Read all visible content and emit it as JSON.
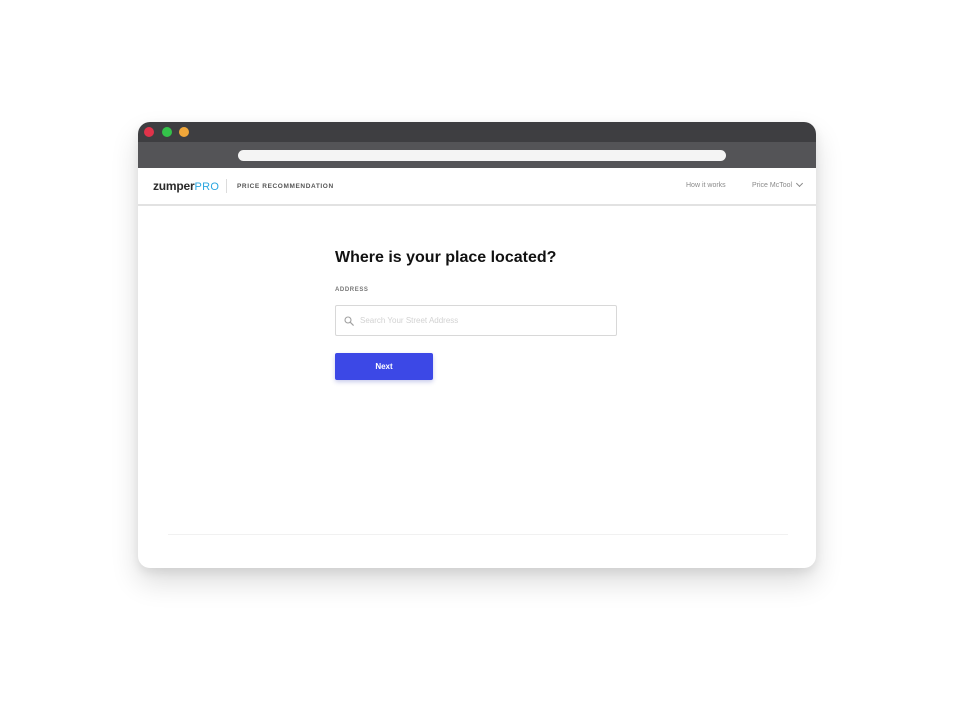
{
  "brand": {
    "logo_main": "zumper",
    "logo_pro": "PRO",
    "accent_color": "#2aa6e0"
  },
  "header": {
    "section_title": "PRICE RECOMMENDATION",
    "nav_link": "How it works",
    "user_name": "Price McTool",
    "user_menu_icon": "chevron-down-icon"
  },
  "main": {
    "title": "Where is your place located?",
    "address_label": "ADDRESS",
    "address_placeholder": "Search Your Street Address",
    "address_value": "",
    "search_icon": "search-icon",
    "next_label": "Next",
    "next_color": "#3c48e6"
  },
  "window": {
    "traffic_lights": [
      "close",
      "zoom",
      "minimize"
    ]
  }
}
